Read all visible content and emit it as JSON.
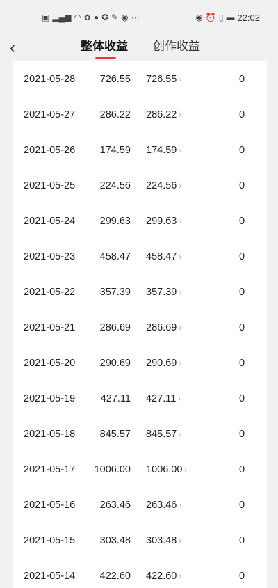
{
  "status": {
    "left_icons": [
      "hd-icon",
      "signal-4g-icon",
      "wifi-icon",
      "app-icon",
      "wechat-icon",
      "app-icon",
      "app-icon",
      "app-icon"
    ],
    "more": "···",
    "time": "22:02"
  },
  "nav": {
    "tab_overall": "整体收益",
    "tab_creation": "创作收益",
    "accent": "#e33333"
  },
  "rows": [
    {
      "date": "2021-05-28",
      "v1": "726.55",
      "v2": "726.55",
      "v3": "0"
    },
    {
      "date": "2021-05-27",
      "v1": "286.22",
      "v2": "286.22",
      "v3": "0"
    },
    {
      "date": "2021-05-26",
      "v1": "174.59",
      "v2": "174.59",
      "v3": "0"
    },
    {
      "date": "2021-05-25",
      "v1": "224.56",
      "v2": "224.56",
      "v3": "0"
    },
    {
      "date": "2021-05-24",
      "v1": "299.63",
      "v2": "299.63",
      "v3": "0"
    },
    {
      "date": "2021-05-23",
      "v1": "458.47",
      "v2": "458.47",
      "v3": "0"
    },
    {
      "date": "2021-05-22",
      "v1": "357.39",
      "v2": "357.39",
      "v3": "0"
    },
    {
      "date": "2021-05-21",
      "v1": "286.69",
      "v2": "286.69",
      "v3": "0"
    },
    {
      "date": "2021-05-20",
      "v1": "290.69",
      "v2": "290.69",
      "v3": "0"
    },
    {
      "date": "2021-05-19",
      "v1": "427.11",
      "v2": "427.11",
      "v3": "0"
    },
    {
      "date": "2021-05-18",
      "v1": "845.57",
      "v2": "845.57",
      "v3": "0"
    },
    {
      "date": "2021-05-17",
      "v1": "1006.00",
      "v2": "1006.00",
      "v3": "0"
    },
    {
      "date": "2021-05-16",
      "v1": "263.46",
      "v2": "263.46",
      "v3": "0"
    },
    {
      "date": "2021-05-15",
      "v1": "303.48",
      "v2": "303.48",
      "v3": "0"
    },
    {
      "date": "2021-05-14",
      "v1": "422.60",
      "v2": "422.60",
      "v3": "0"
    }
  ]
}
